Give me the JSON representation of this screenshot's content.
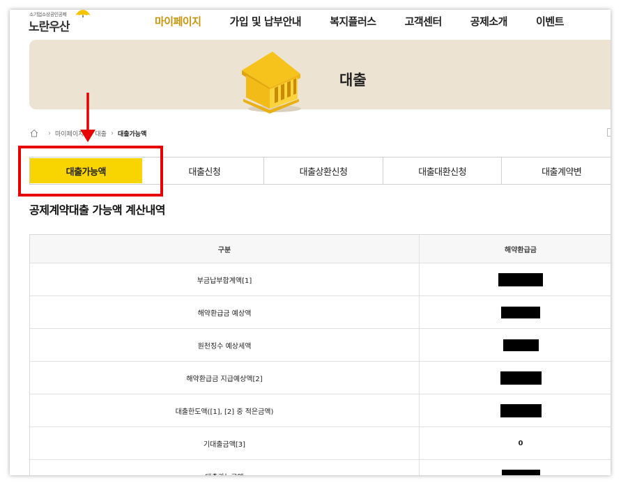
{
  "logo": {
    "tagline": "소기업소상공인공제",
    "name": "노란우산"
  },
  "nav": {
    "items": [
      "마이페이지",
      "가입 및 납부안내",
      "복지플러스",
      "고객센터",
      "공제소개",
      "이벤트"
    ]
  },
  "banner": {
    "title": "대출"
  },
  "breadcrumb": {
    "items": [
      "마이페이지",
      "대출",
      "대출가능액"
    ]
  },
  "tabs": {
    "items": [
      "대출가능액",
      "대출신청",
      "대출상환신청",
      "대출대환신청",
      "대출계약변"
    ]
  },
  "section": {
    "title": "공제계약대출 가능액 계산내역"
  },
  "table": {
    "headers": [
      "구분",
      "해약환급금"
    ],
    "rows": [
      {
        "label": "부금납부합계액[1]",
        "value": "",
        "redacted": true
      },
      {
        "label": "해약환급금 예상액",
        "value": "",
        "redacted": true
      },
      {
        "label": "원천징수 예상세액",
        "value": "",
        "redacted": true
      },
      {
        "label": "해약환급금 지급예상액[2]",
        "value": "",
        "redacted": true
      },
      {
        "label": "대출한도액([1], [2] 중 적은금액)",
        "value": "",
        "redacted": true
      },
      {
        "label": "기대출금액[3]",
        "value": "0",
        "redacted": false
      },
      {
        "label": "대출가능금액",
        "value": "",
        "redacted": true
      }
    ]
  },
  "colors": {
    "accent": "#f8d400",
    "nav_active": "#c9930c",
    "banner_bg": "#ece3d3",
    "annotation": "#e60000"
  },
  "icons": [
    "umbrella-icon",
    "bank-icon",
    "home-icon",
    "chevron-right-icon",
    "arrow-down-icon"
  ]
}
